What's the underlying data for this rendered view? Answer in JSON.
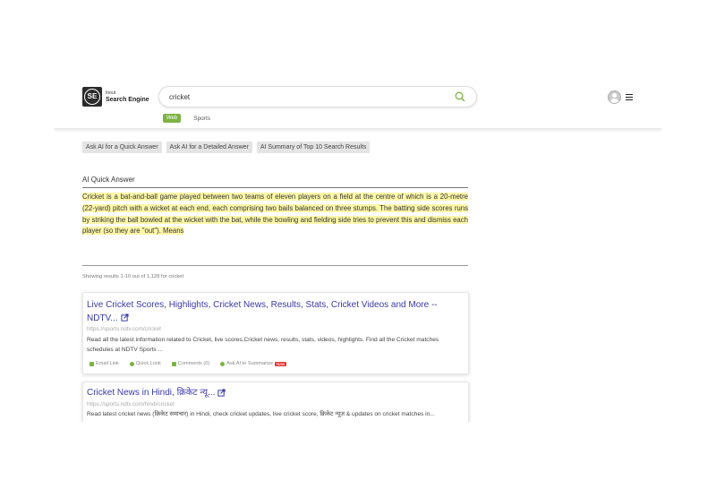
{
  "logo": {
    "small": "Inout",
    "name": "Search Engine",
    "mark": "SE"
  },
  "search": {
    "query": "cricket"
  },
  "tabs": [
    {
      "label": "Web"
    },
    {
      "label": "Sports"
    }
  ],
  "ai_buttons": [
    "Ask AI for a Quick Answer",
    "Ask AI for a Detailed Answer",
    "AI Summary of Top 10 Search Results"
  ],
  "quick_answer": {
    "title": "AI Quick Answer",
    "text": "Cricket is a bat-and-ball game played between two teams of eleven players on a field at the centre of which is a 20-metre (22-yard) pitch with a wicket at each end, each comprising two bails balanced on three stumps. The batting side scores runs by striking the ball bowled at the wicket with the bat, while the bowling and fielding side tries to prevent this and dismiss each player (so they are \"out\"). Means"
  },
  "results_count": "Showing results 1-10 out of 1,128 for cricket",
  "results": [
    {
      "title": "Live Cricket Scores, Highlights, Cricket News, Results, Stats, Cricket Videos and More -- NDTV...",
      "url": "https://sports.ndtv.com/cricket",
      "snippet": "Read all the latest information related to Cricket, live scores,Cricket news, results, stats, videos, highlights. Find all the Cricket matches schedules at NDTV Sports ..."
    },
    {
      "title": "Cricket News in Hindi, क्रिकेट न्यू...",
      "url": "https://sports.ndtv.com/hindi/cricket",
      "snippet": "Read latest cricket news (क्रिकेट समाचार) in Hindi, check cricket updates, live cricket score, क्रिकेट न्यूज़ & updates on cricket matches in..."
    }
  ],
  "actions": {
    "email": "Email Link",
    "quick_look": "Quick Look",
    "comments": "Comments (0)",
    "ai_summarizer": "Ask AI to Summarize",
    "new_badge": "New"
  },
  "colors": {
    "accent_green": "#7cb342",
    "link_blue": "#3a3aa8",
    "highlight": "#fdf7a8",
    "badge_red": "#e53935"
  }
}
